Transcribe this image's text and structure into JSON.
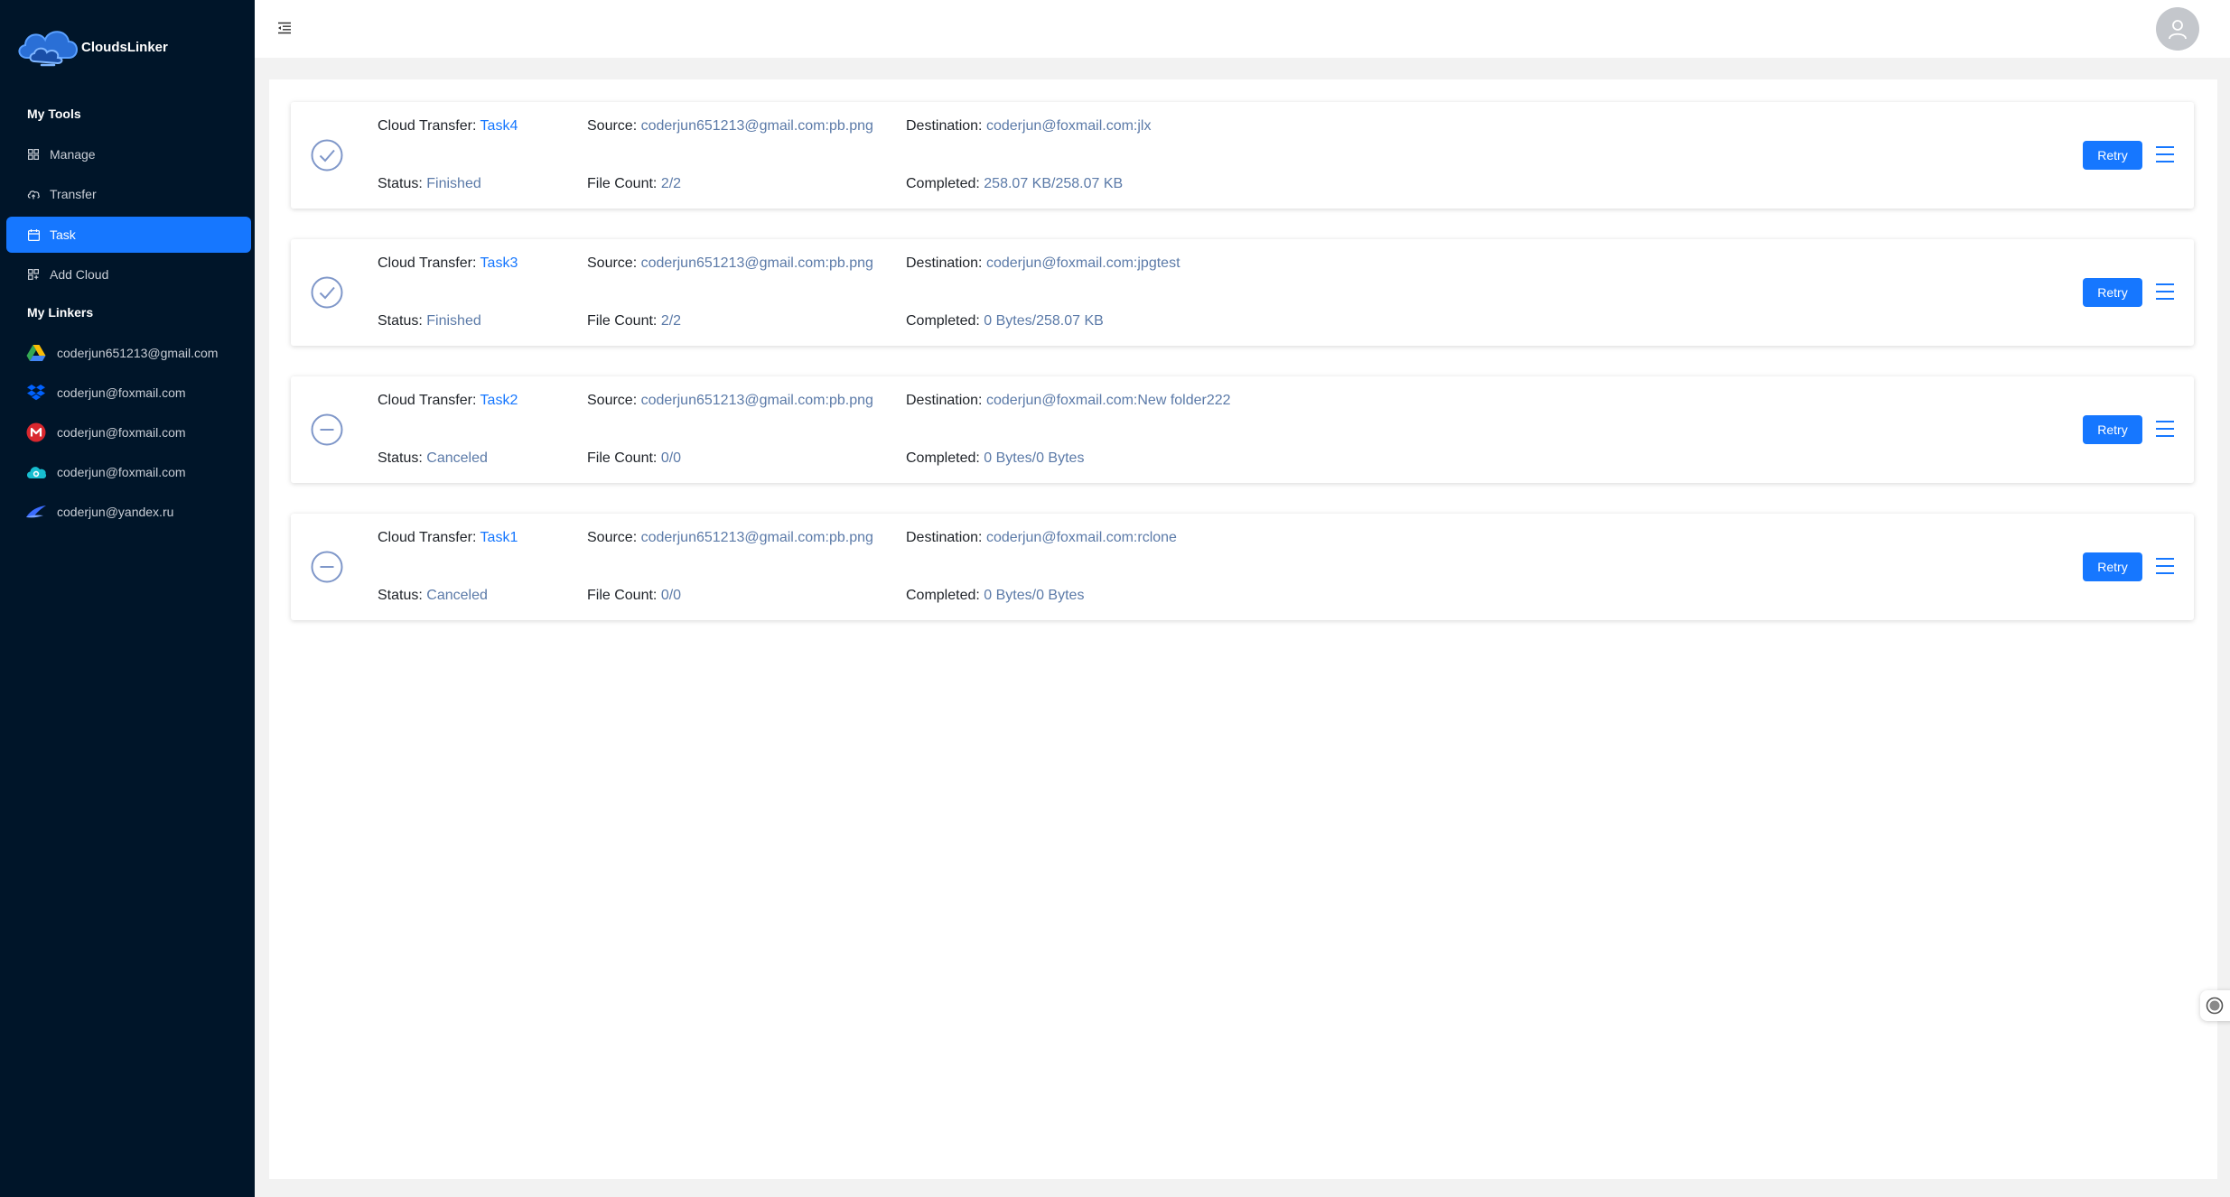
{
  "app": {
    "name": "CloudsLinker",
    "brand_color": "#1677ff",
    "sidebar_bg": "#001529"
  },
  "sidebar": {
    "tools_title": "My Tools",
    "tools": [
      {
        "label": "Manage",
        "icon": "grid-icon",
        "active": false
      },
      {
        "label": "Transfer",
        "icon": "cloud-upload-icon",
        "active": false
      },
      {
        "label": "Task",
        "icon": "calendar-icon",
        "active": true
      },
      {
        "label": "Add Cloud",
        "icon": "grid-plus-icon",
        "active": false
      }
    ],
    "linkers_title": "My Linkers",
    "linkers": [
      {
        "label": "coderjun651213@gmail.com",
        "icon": "google-drive-icon"
      },
      {
        "label": "coderjun@foxmail.com",
        "icon": "dropbox-icon"
      },
      {
        "label": "coderjun@foxmail.com",
        "icon": "mega-icon"
      },
      {
        "label": "coderjun@foxmail.com",
        "icon": "pcloud-icon"
      },
      {
        "label": "coderjun@yandex.ru",
        "icon": "yandex-disk-icon"
      }
    ]
  },
  "tasks": [
    {
      "transfer_label": "Cloud Transfer:",
      "name": "Task4",
      "source_label": "Source:",
      "source": "coderjun651213@gmail.com:pb.png",
      "destination_label": "Destination:",
      "destination": "coderjun@foxmail.com:jlx",
      "status_label": "Status:",
      "status": "Finished",
      "status_icon": "check-circle-icon",
      "file_count_label": "File Count:",
      "file_count": "2/2",
      "completed_label": "Completed:",
      "completed": "258.07 KB/258.07 KB",
      "retry_label": "Retry"
    },
    {
      "transfer_label": "Cloud Transfer:",
      "name": "Task3",
      "source_label": "Source:",
      "source": "coderjun651213@gmail.com:pb.png",
      "destination_label": "Destination:",
      "destination": "coderjun@foxmail.com:jpgtest",
      "status_label": "Status:",
      "status": "Finished",
      "status_icon": "check-circle-icon",
      "file_count_label": "File Count:",
      "file_count": "2/2",
      "completed_label": "Completed:",
      "completed": "0 Bytes/258.07 KB",
      "retry_label": "Retry"
    },
    {
      "transfer_label": "Cloud Transfer:",
      "name": "Task2",
      "source_label": "Source:",
      "source": "coderjun651213@gmail.com:pb.png",
      "destination_label": "Destination:",
      "destination": "coderjun@foxmail.com:New folder222",
      "status_label": "Status:",
      "status": "Canceled",
      "status_icon": "minus-circle-icon",
      "file_count_label": "File Count:",
      "file_count": "0/0",
      "completed_label": "Completed:",
      "completed": "0 Bytes/0 Bytes",
      "retry_label": "Retry"
    },
    {
      "transfer_label": "Cloud Transfer:",
      "name": "Task1",
      "source_label": "Source:",
      "source": "coderjun651213@gmail.com:pb.png",
      "destination_label": "Destination:",
      "destination": "coderjun@foxmail.com:rclone",
      "status_label": "Status:",
      "status": "Canceled",
      "status_icon": "minus-circle-icon",
      "file_count_label": "File Count:",
      "file_count": "0/0",
      "completed_label": "Completed:",
      "completed": "0 Bytes/0 Bytes",
      "retry_label": "Retry"
    }
  ]
}
